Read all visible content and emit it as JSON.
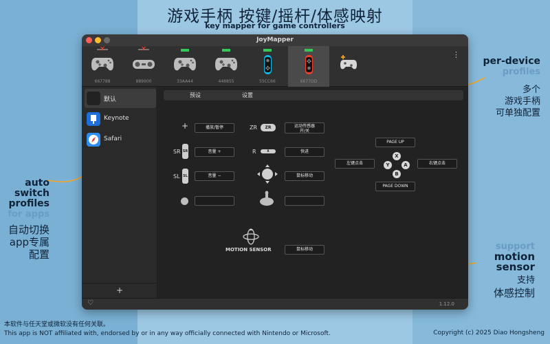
{
  "hero": {
    "title": "游戏手柄 按键/摇杆/体感映射",
    "subtitle": "key mapper for game controllers"
  },
  "annotations": {
    "per_device": {
      "line1": "per-device",
      "line2": "profiles",
      "zh1": "多个",
      "zh2": "游戏手柄",
      "zh3": "可单独配置"
    },
    "auto_switch": {
      "line1": "auto",
      "line2": "switch",
      "line3": "profiles",
      "line4": "for apps",
      "zh1": "自动切换",
      "zh2": "app专属",
      "zh3": "配置"
    },
    "motion": {
      "line1": "support",
      "line2": "motion",
      "line3": "sensor",
      "zh1": "支持",
      "zh2": "体感控制"
    }
  },
  "footer": {
    "disclaimer_zh": "本软件与任天堂或微软没有任何关联。",
    "disclaimer_en": "This app is NOT affiliated with, endorsed by or in any way officially connected with Nintendo or Microsoft.",
    "copyright": "Copyright (c) 2025 Diao Hongsheng"
  },
  "window": {
    "title": "JoyMapper",
    "version": "1.12.0"
  },
  "devices": [
    {
      "id": "667788",
      "status": "disconnected",
      "icon": "gamepad-icon"
    },
    {
      "id": "889900",
      "status": "disconnected",
      "icon": "snes-controller-icon"
    },
    {
      "id": "33AA44",
      "status": "connected",
      "icon": "gamepad-icon"
    },
    {
      "id": "448855",
      "status": "connected",
      "icon": "gamepad-icon"
    },
    {
      "id": "55CC66",
      "status": "connected",
      "icon": "joycon-blue-icon"
    },
    {
      "id": "6677DD",
      "status": "connected",
      "icon": "joycon-red-icon",
      "selected": true
    }
  ],
  "colors": {
    "connected": "#35c759",
    "disconnected": "#ff3b30",
    "joycon_blue": "#0ab9e6",
    "joycon_red": "#ff3c28",
    "keynote": "#1e6fd9",
    "safari": "#2f8ff0",
    "arrow": "#f5a623"
  },
  "sidebar": {
    "items": [
      {
        "label": "默认",
        "icon": "default-profile-icon"
      },
      {
        "label": "Keynote",
        "icon": "keynote-icon"
      },
      {
        "label": "Safari",
        "icon": "safari-icon"
      }
    ],
    "add_label": "+"
  },
  "tabs": {
    "presets": "预设",
    "settings": "设置"
  },
  "mapping": {
    "plus_glyph": "+",
    "plus_action": "播放/暂停",
    "zr_label": "ZR",
    "zr_badge": "ZR",
    "zr_action_line1": "运动传感器",
    "zr_action_line2": "开/关",
    "sr_label": "SR",
    "sr_badge": "SR",
    "sr_action": "音量 +",
    "r_label": "R",
    "r_badge": "R",
    "r_action": "快进",
    "sl_label": "SL",
    "sl_badge": "SL",
    "sl_action": "音量 −",
    "stick_push_action": "鼠标移动",
    "home_action": "",
    "stick_press_action": "",
    "motion_label": "MOTION SENSOR",
    "motion_action": "鼠标移动",
    "page_up": "PAGE UP",
    "page_down": "PAGE DOWN",
    "left_click": "左键点击",
    "right_click": "右键点击",
    "face_x": "X",
    "face_y": "Y",
    "face_a": "A",
    "face_b": "B"
  },
  "icons": {
    "kebab": "⋮",
    "heart": "♡"
  }
}
